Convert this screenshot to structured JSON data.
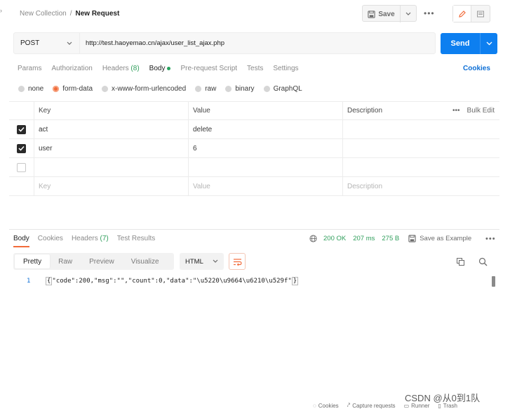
{
  "header": {
    "breadcrumb_collection": "New Collection",
    "breadcrumb_separator": "/",
    "breadcrumb_current": "New Request",
    "save_label": "Save",
    "more_label": "•••"
  },
  "request": {
    "method": "POST",
    "url": "http://test.haoyemao.cn/ajax/user_list_ajax.php",
    "send_label": "Send"
  },
  "tabs": {
    "params": "Params",
    "authorization": "Authorization",
    "headers": "Headers",
    "headers_count": "(8)",
    "body": "Body",
    "pre_request": "Pre-request Script",
    "tests": "Tests",
    "settings": "Settings",
    "cookies": "Cookies"
  },
  "body_types": [
    "none",
    "form-data",
    "x-www-form-urlencoded",
    "raw",
    "binary",
    "GraphQL"
  ],
  "body_type_selected": "form-data",
  "form_table": {
    "headers": {
      "key": "Key",
      "value": "Value",
      "description": "Description",
      "bulk_edit": "Bulk Edit"
    },
    "rows": [
      {
        "key": "act",
        "value": "delete",
        "description": "",
        "checked": true
      },
      {
        "key": "user",
        "value": "6",
        "description": "",
        "checked": true
      }
    ],
    "placeholders": {
      "key": "Key",
      "value": "Value",
      "description": "Description"
    }
  },
  "response": {
    "tabs": {
      "body": "Body",
      "cookies": "Cookies",
      "headers": "Headers",
      "headers_count": "(7)",
      "test_results": "Test Results"
    },
    "status": "200 OK",
    "time": "207 ms",
    "size": "275 B",
    "save_example": "Save as Example",
    "view_options": [
      "Pretty",
      "Raw",
      "Preview",
      "Visualize"
    ],
    "view_selected": "Pretty",
    "format": "HTML",
    "line_number": "1",
    "body_text_open": "{",
    "body_text_mid": "\"code\":200,\"msg\":\"\",\"count\":0,\"data\":\"\\u5220\\u9664\\u6210\\u529f\"",
    "body_text_close": "}"
  },
  "watermark": "CSDN @从0到1队",
  "status_bar": [
    "Cookies",
    "Capture requests",
    "Runner",
    "Trash"
  ],
  "colors": {
    "accent_orange": "#f26b3a",
    "send_blue": "#0d7ff0",
    "status_green": "#2f9e5b",
    "link_blue": "#0d6fd6"
  }
}
